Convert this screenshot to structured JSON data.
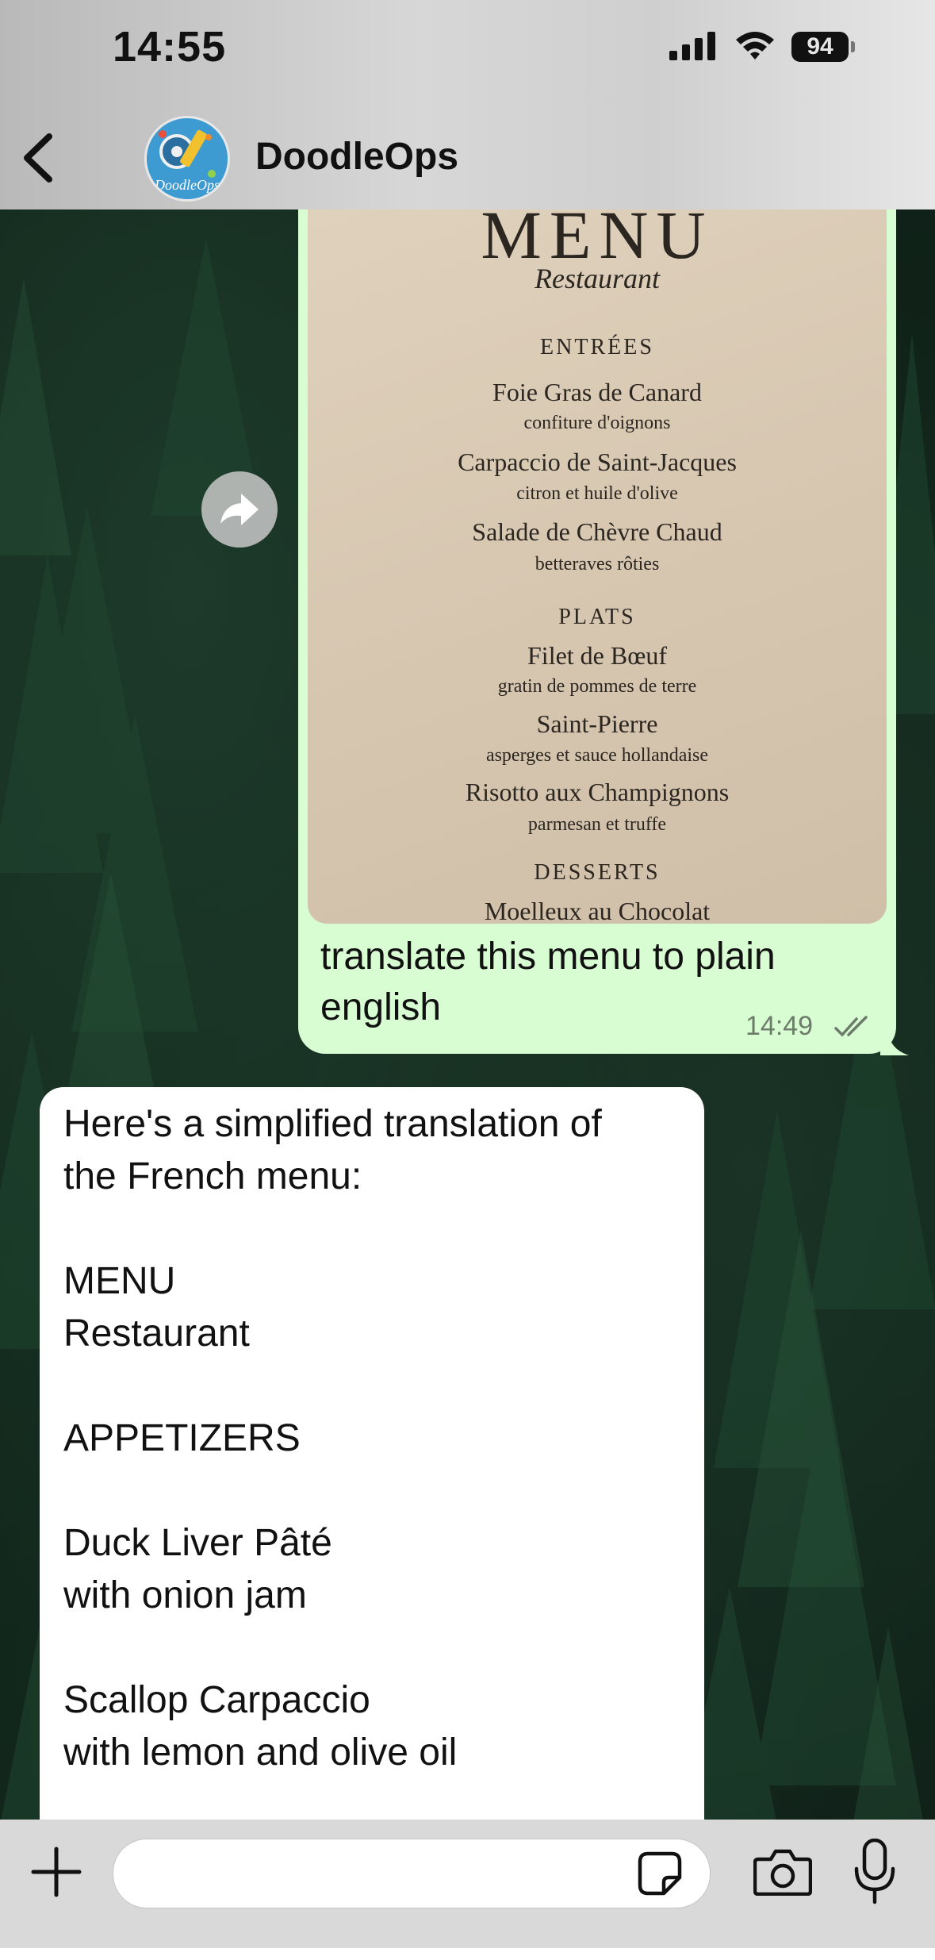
{
  "status_bar": {
    "time": "14:55",
    "battery": "94"
  },
  "header": {
    "chat_name": "DoodleOps",
    "avatar_text": "DoodleOps"
  },
  "outgoing_message": {
    "image_menu": {
      "title": "MENU",
      "subtitle": "Restaurant",
      "sections": [
        {
          "name": "ENTRÉES",
          "items": [
            {
              "dish": "Foie Gras de Canard",
              "desc": "confiture d'oignons"
            },
            {
              "dish": "Carpaccio de Saint-Jacques",
              "desc": "citron et huile d'olive"
            },
            {
              "dish": "Salade de Chèvre Chaud",
              "desc": "betteraves rôties"
            }
          ]
        },
        {
          "name": "PLATS",
          "items": [
            {
              "dish": "Filet de Bœuf",
              "desc": "gratin de pommes de terre"
            },
            {
              "dish": "Saint-Pierre",
              "desc": "asperges et sauce hollandaise"
            },
            {
              "dish": "Risotto aux Champignons",
              "desc": "parmesan et truffe"
            }
          ]
        },
        {
          "name": "DESSERTS",
          "items": [
            {
              "dish": "Moelleux au Chocolat"
            }
          ]
        }
      ]
    },
    "text_line1": "translate this menu to plain",
    "text_line2": "english",
    "time": "14:49"
  },
  "incoming_message": {
    "lines": [
      "Here's a simplified translation of",
      "the French menu:",
      "",
      "MENU",
      "Restaurant",
      "",
      "APPETIZERS",
      "",
      "Duck Liver Pâté",
      "with onion jam",
      "",
      "Scallop Carpaccio",
      "with lemon and olive oil"
    ]
  },
  "composer": {
    "placeholder": ""
  },
  "colors": {
    "outgoing_bubble": "#d9fdd3",
    "incoming_bubble": "#ffffff",
    "header_bg": "#d0d0d0"
  }
}
